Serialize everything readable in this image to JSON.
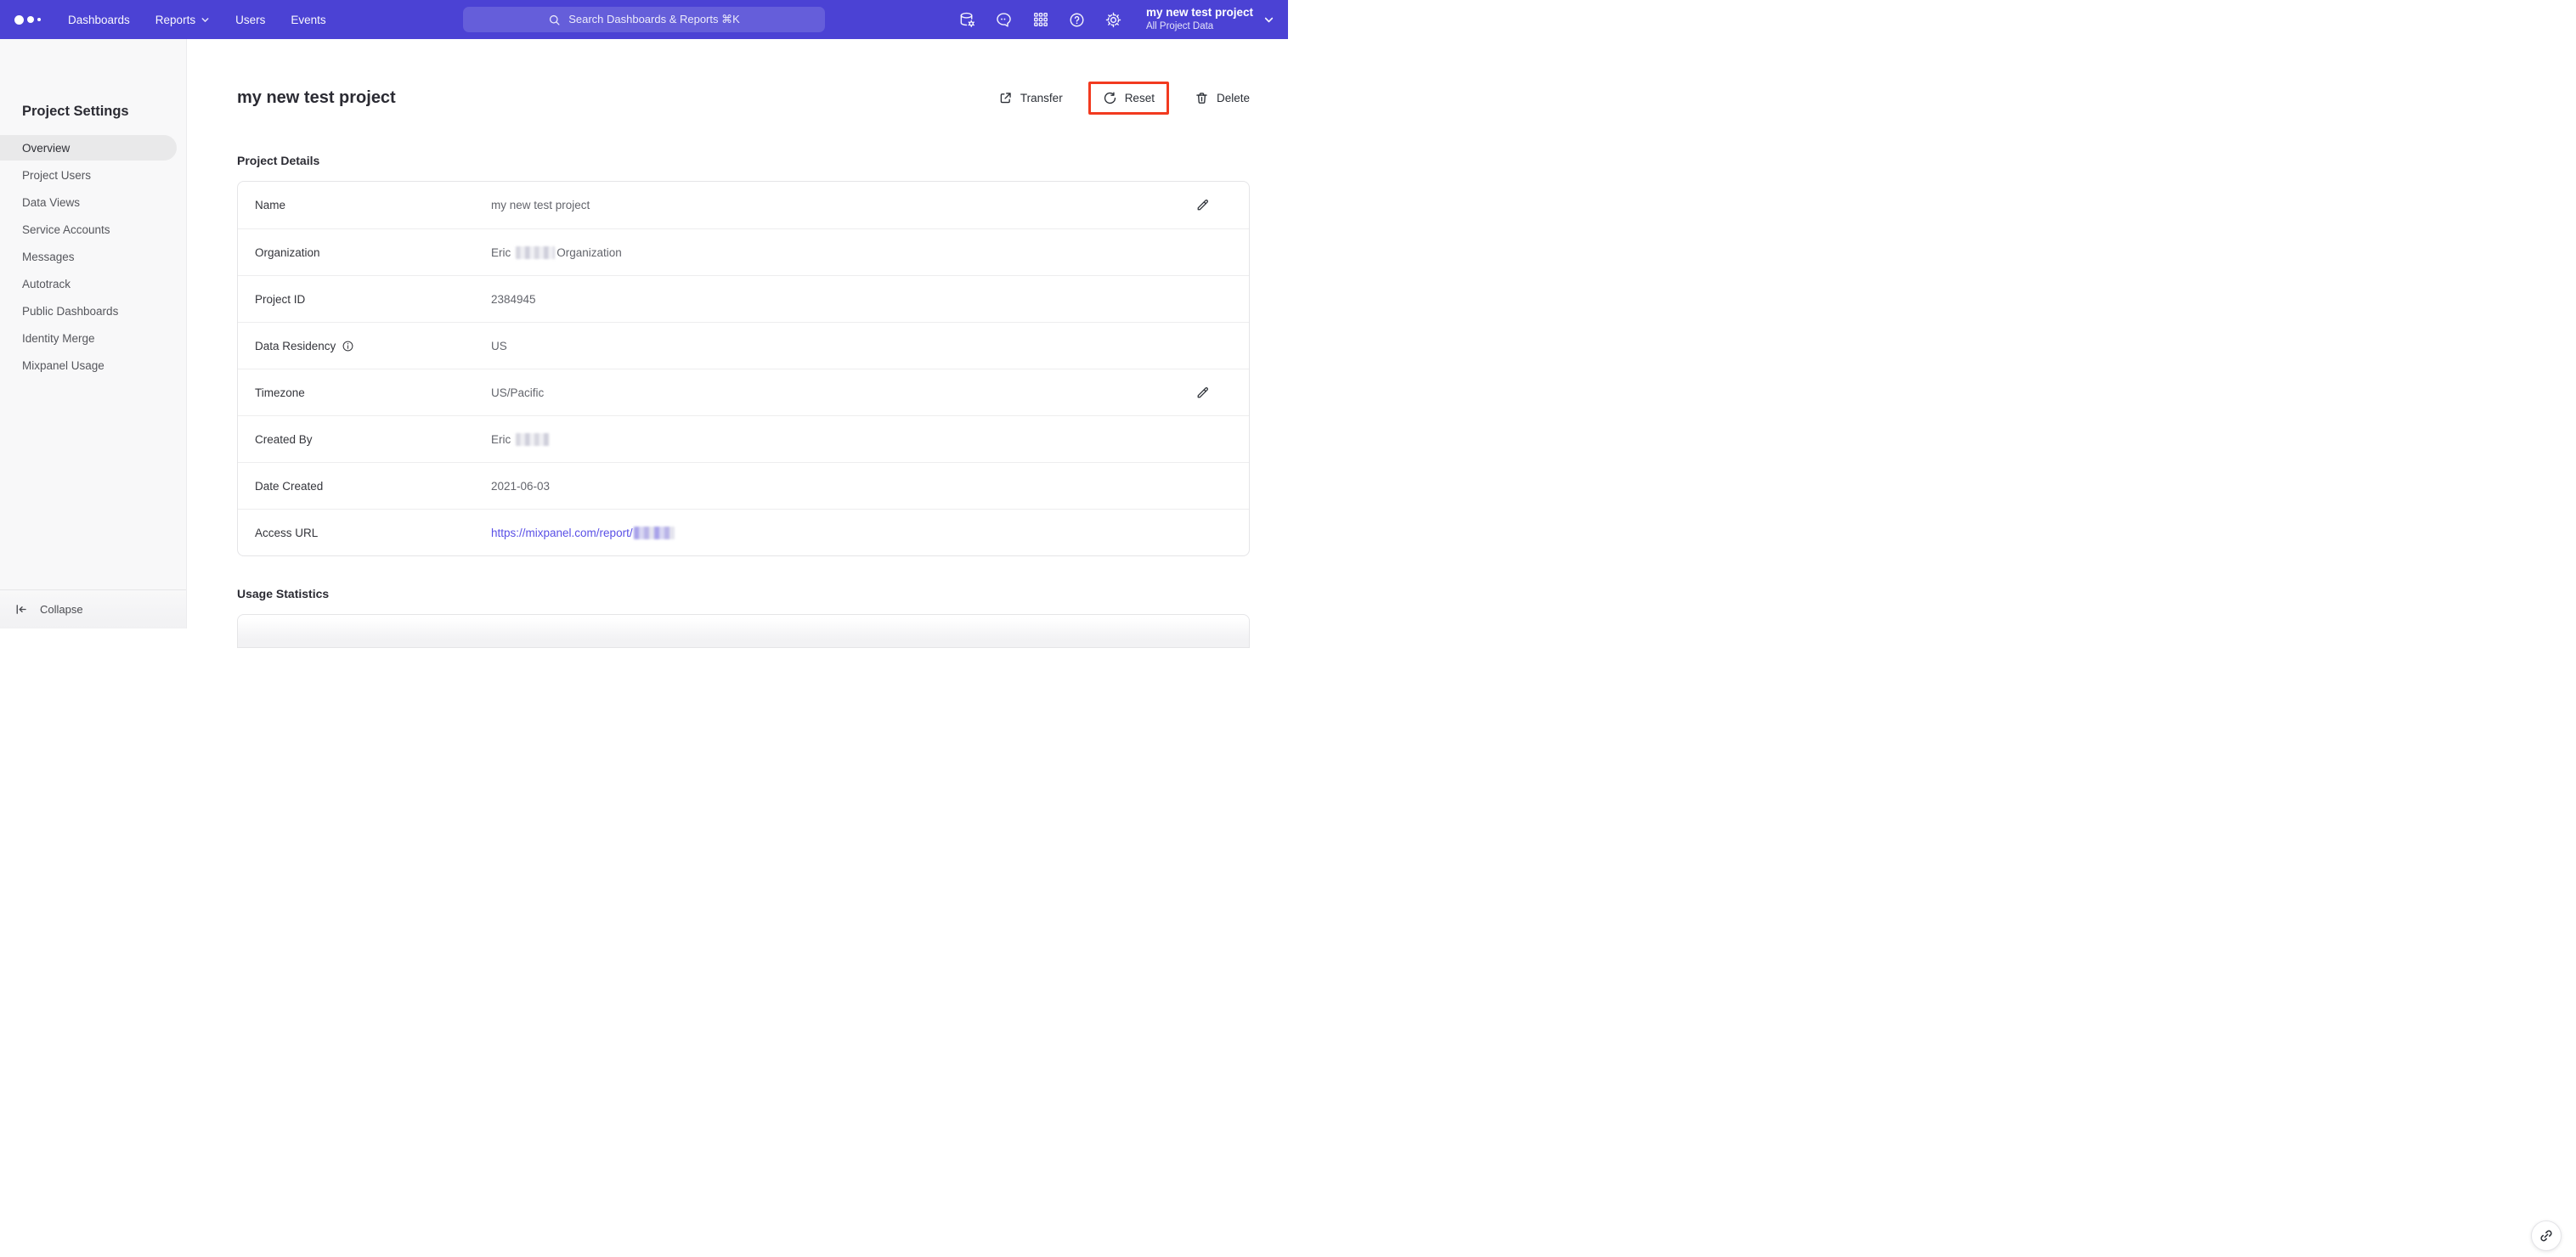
{
  "colors": {
    "nav_bg": "#4b42d4",
    "annotation_red": "#f23a1f",
    "link": "#5a50e6",
    "active_item_bg": "#e9e9ea"
  },
  "nav": {
    "items": [
      "Dashboards",
      "Reports",
      "Users",
      "Events"
    ],
    "search_placeholder": "Search Dashboards & Reports ⌘K",
    "project_name": "my new test project",
    "project_scope": "All Project Data",
    "right_icons": [
      "data-management",
      "feedback",
      "apps-grid",
      "help",
      "settings"
    ]
  },
  "sidebar": {
    "title": "Project Settings",
    "items": [
      "Overview",
      "Project Users",
      "Data Views",
      "Service Accounts",
      "Messages",
      "Autotrack",
      "Public Dashboards",
      "Identity Merge",
      "Mixpanel Usage"
    ],
    "active_item": "Overview",
    "collapse_label": "Collapse"
  },
  "main": {
    "title": "my new test project",
    "actions": {
      "transfer": "Transfer",
      "reset": "Reset",
      "delete": "Delete"
    },
    "details": {
      "heading": "Project Details",
      "rows": [
        {
          "label": "Name",
          "value": "my new test project"
        },
        {
          "label": "Organization",
          "value_prefix": "Eric",
          "value_suffix": "Organization"
        },
        {
          "label": "Project ID",
          "value": "2384945"
        },
        {
          "label": "Data Residency",
          "value": "US"
        },
        {
          "label": "Timezone",
          "value": "US/Pacific"
        },
        {
          "label": "Created By",
          "value_prefix": "Eric"
        },
        {
          "label": "Date Created",
          "value": "2021-06-03"
        },
        {
          "label": "Access URL",
          "link_text": "https://mixpanel.com/report/"
        }
      ]
    },
    "usage_heading": "Usage Statistics"
  }
}
